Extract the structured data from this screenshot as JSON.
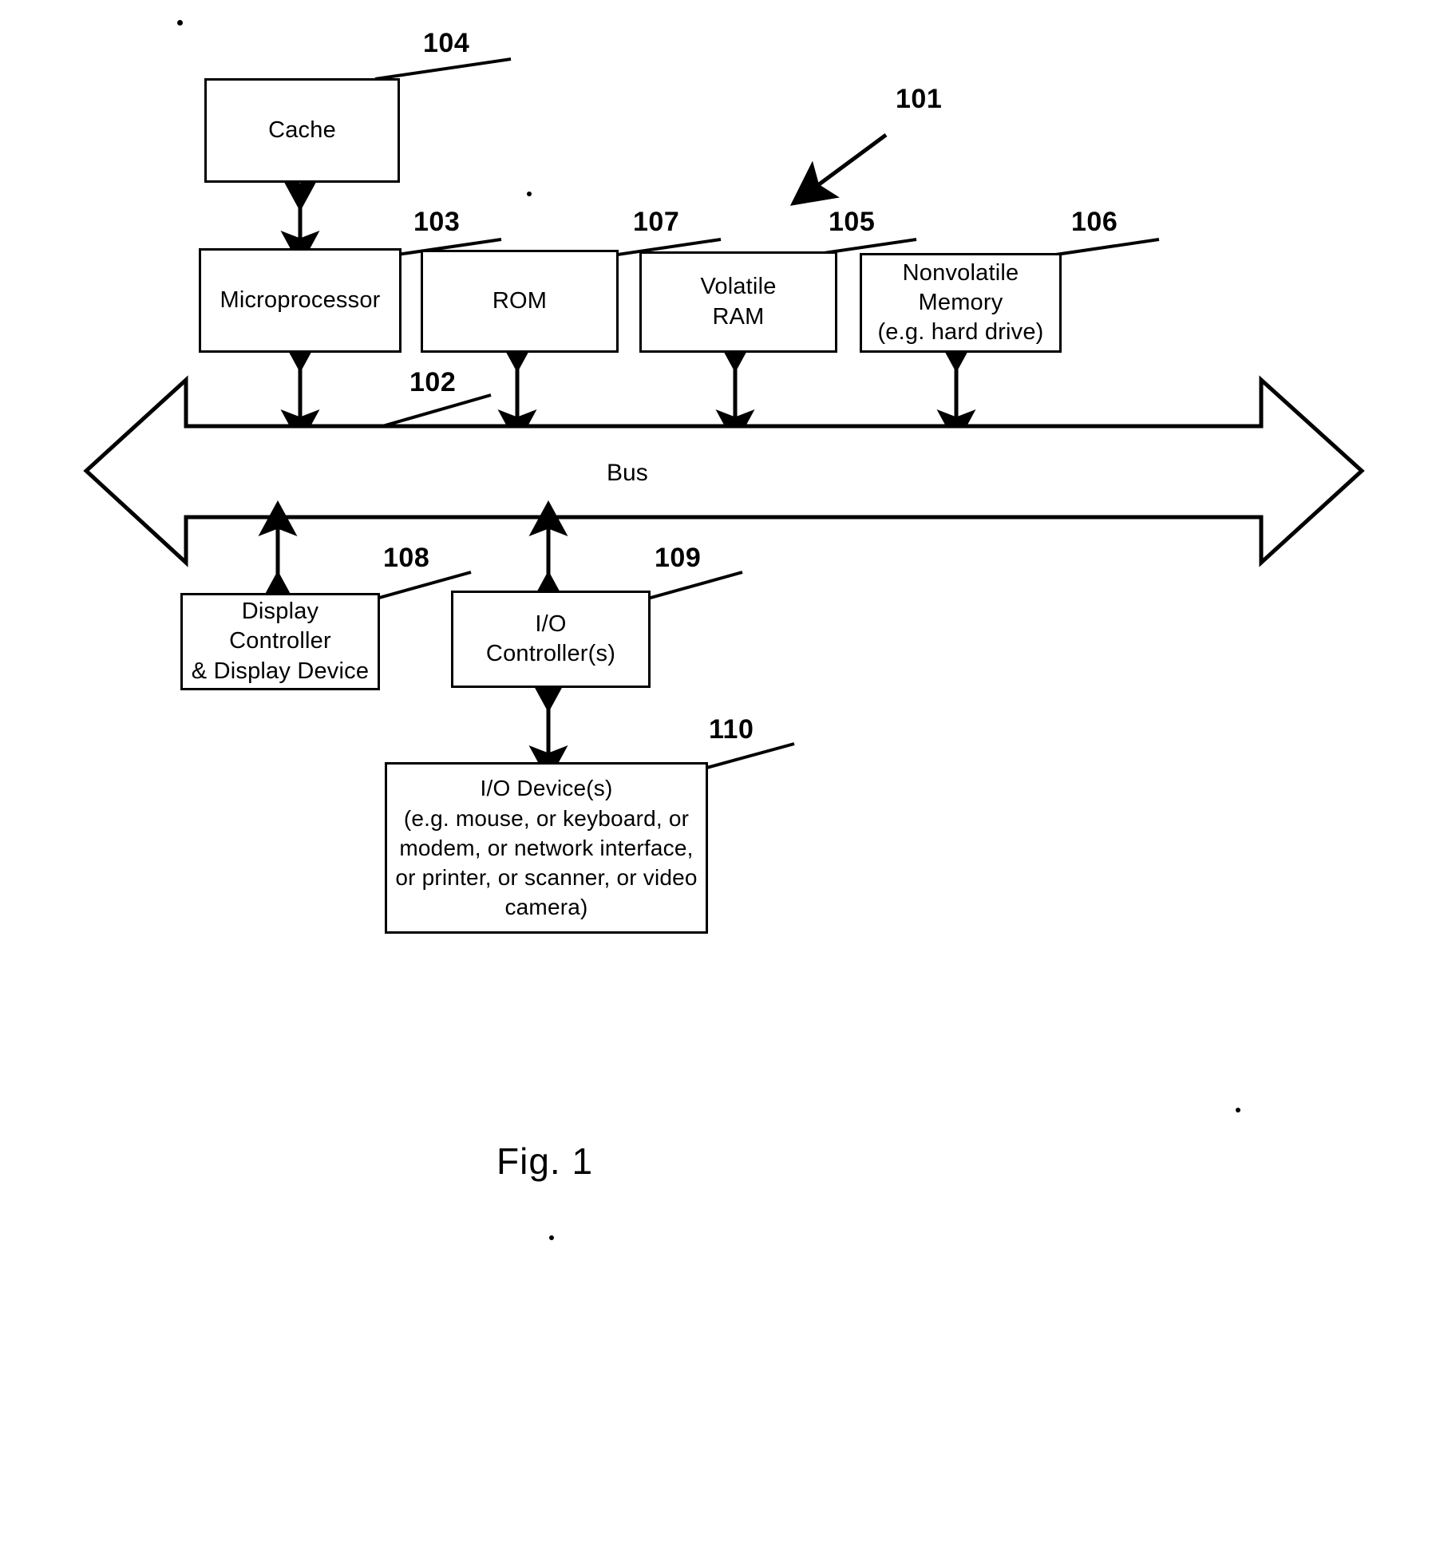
{
  "figure": {
    "caption": "Fig. 1",
    "system_ref": "101"
  },
  "blocks": [
    {
      "id": "cache",
      "label": "Cache",
      "ref": "104"
    },
    {
      "id": "microprocessor",
      "label": "Microprocessor",
      "ref": "103"
    },
    {
      "id": "rom",
      "label": "ROM",
      "ref": "107"
    },
    {
      "id": "volatile_ram",
      "label": "Volatile\nRAM",
      "ref": "105"
    },
    {
      "id": "nonvolatile_memory",
      "label": "Nonvolatile\nMemory\n(e.g. hard drive)",
      "ref": "106"
    },
    {
      "id": "bus",
      "label": "Bus",
      "ref": "102"
    },
    {
      "id": "display_controller",
      "label": "Display Controller\n& Display Device",
      "ref": "108"
    },
    {
      "id": "io_controller",
      "label": "I/O\nController(s)",
      "ref": "109"
    },
    {
      "id": "io_devices",
      "label": "I/O Device(s)\n(e.g. mouse, or keyboard, or\nmodem, or network interface,\nor printer, or scanner, or video\ncamera)",
      "ref": "110"
    }
  ],
  "colors": {
    "stroke": "#000000",
    "background": "#ffffff"
  }
}
